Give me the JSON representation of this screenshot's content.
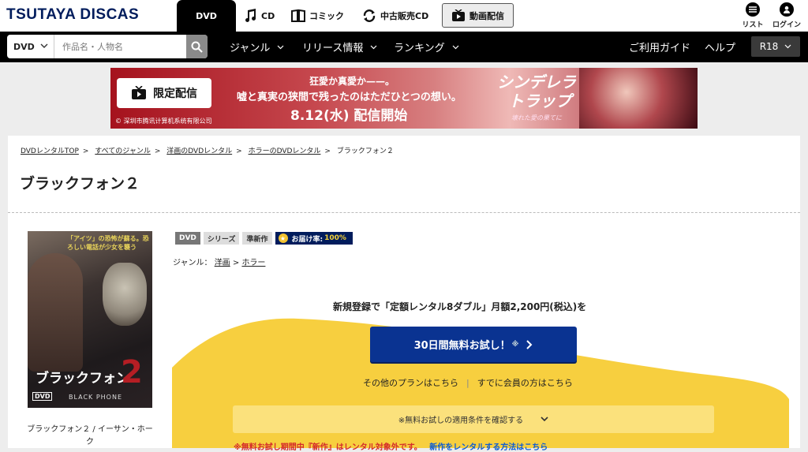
{
  "header": {
    "logo": "TSUTAYA DISCAS",
    "categories": [
      {
        "label": "DVD",
        "icon": "disc-icon"
      },
      {
        "label": "CD",
        "icon": "music-note-icon"
      },
      {
        "label": "コミック",
        "icon": "book-icon"
      },
      {
        "label": "中古販売CD",
        "icon": "recycle-icon"
      },
      {
        "label": "動画配信",
        "icon": "tv-play-icon"
      }
    ],
    "list_label": "リスト",
    "login_label": "ログイン"
  },
  "nav": {
    "search_category": "DVD",
    "search_placeholder": "作品名・人物名",
    "genre": "ジャンル",
    "release": "リリース情報",
    "ranking": "ランキング",
    "guide": "ご利用ガイド",
    "help": "ヘルプ",
    "r18": "R18"
  },
  "banner": {
    "badge": "限定配信",
    "line1": "狂愛か真愛か——。",
    "line2": "嘘と真実の狭間で残ったのはただひとつの想い。",
    "line3": "8.12(水) 配信開始",
    "title_line1": "シンデレラ",
    "title_line2": "トラップ",
    "subtitle": "壊れた愛の果てに",
    "copyright": "© 深圳市腾讯计算机系统有限公司"
  },
  "breadcrumb": [
    "DVDレンタルTOP",
    "すべてのジャンル",
    "洋画のDVDレンタル",
    "ホラーのDVDレンタル",
    "ブラックフォン２"
  ],
  "product": {
    "title": "ブラックフォン２",
    "cover": {
      "tagline": "「アイツ」の恐怖が蘇る。恐ろしい電話が少女を襲う",
      "title": "ブラックフォン",
      "number": "2",
      "english": "BLACK PHONE",
      "format": "DVD"
    },
    "caption": "ブラックフォン２ / イーサン・ホーク",
    "tags": [
      "DVD",
      "シリーズ",
      "準新作"
    ],
    "delivery_label": "お届け率:",
    "delivery_rate": "100%",
    "genre_label": "ジャンル：",
    "genre_links": [
      "洋画",
      "ホラー"
    ]
  },
  "promo": {
    "headline": "新規登録で「定額レンタル8ダブル」月額2,200円(税込)を",
    "cta_label": "30日間無料お試し！",
    "cta_mark": "※",
    "link_other": "その他のプランはこちら",
    "link_member": "すでに会員の方はこちら",
    "conditions": "※無料お試しの適用条件を確認する",
    "note": "※無料お試し期間中『新作』はレンタル対象外です。",
    "note_link": "新作をレンタルする方法はこちら"
  },
  "colors": {
    "brand_navy": "#001c5c",
    "cta_blue": "#0a3391",
    "promo_yellow": "#f7cf3f",
    "alert_red": "#d42a2a"
  }
}
